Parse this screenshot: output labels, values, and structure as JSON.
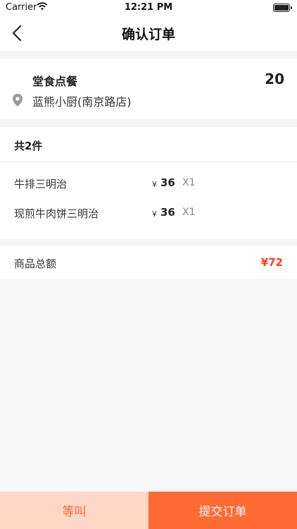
{
  "status_bar": {
    "carrier": "Carrier",
    "time": "12:21 PM"
  },
  "nav": {
    "title": "确认订单",
    "back_icon": "chevron-left-icon"
  },
  "shop": {
    "order_type": "堂食点餐",
    "table_number": "20",
    "name": "蓝熊小厨(南京路店)",
    "location_icon": "map-pin-icon"
  },
  "items": {
    "count_label": "共2件",
    "list": [
      {
        "name": "牛排三明治",
        "currency": "¥",
        "price": "36",
        "qty": "X1"
      },
      {
        "name": "现煎牛肉饼三明治",
        "currency": "¥",
        "price": "36",
        "qty": "X1"
      }
    ]
  },
  "total": {
    "label": "商品总额",
    "amount": "¥72"
  },
  "actions": {
    "wait_label": "等叫",
    "submit_label": "提交订单"
  },
  "colors": {
    "accent": "#ff6a35",
    "accent_light": "#ffd7c7",
    "price_red": "#ff3b1f"
  }
}
